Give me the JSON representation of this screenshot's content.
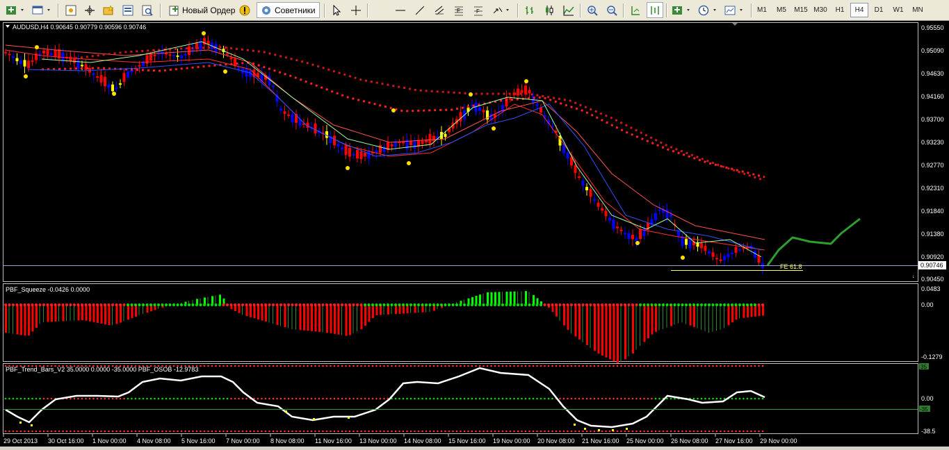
{
  "toolbar": {
    "new_order_label": "Новый Ордер",
    "advisors_label": "Советники",
    "timeframes": [
      "M1",
      "M5",
      "M15",
      "M30",
      "H1",
      "H4",
      "D1",
      "W1",
      "MN"
    ],
    "active_timeframe": "H4"
  },
  "main_chart": {
    "info_text": "AUDUSD,H4  0.90645 0.90779 0.90596 0.90746",
    "price_labels": [
      "0.95550",
      "0.95090",
      "0.94630",
      "0.94160",
      "0.93700",
      "0.93230",
      "0.92770",
      "0.92310",
      "0.91840",
      "0.91380",
      "0.90920",
      "0.90450"
    ],
    "current_price": "0.90746",
    "fe_label": "FE 61.8"
  },
  "squeeze": {
    "info_text": "PBF_Squeeze -0.0426 0.0000",
    "scale_labels": [
      "0.0483",
      "0.00",
      "-0.1279"
    ]
  },
  "trend_bars": {
    "info_text": "PBF_Trend_Bars_V2 35.0000 0.0000 -35.0000  PBF_OSOB -12.9783",
    "scale_labels": [
      "0.00",
      "-38.5"
    ],
    "marker_labels": [
      "35",
      "-35"
    ]
  },
  "time_labels": [
    "29 Oct 2013",
    "30 Oct 16:00",
    "1 Nov 00:00",
    "4 Nov 08:00",
    "5 Nov 16:00",
    "7 Nov 00:00",
    "8 Nov 08:00",
    "11 Nov 16:00",
    "13 Nov 00:00",
    "14 Nov 08:00",
    "15 Nov 16:00",
    "19 Nov 00:00",
    "20 Nov 08:00",
    "21 Nov 16:00",
    "25 Nov 00:00",
    "26 Nov 08:00",
    "27 Nov 16:00",
    "29 Nov 00:00"
  ],
  "colors": {
    "bull_candle": "#0000ff",
    "bear_candle": "#ff0000",
    "neutral_candle": "#ffff00",
    "squeeze_pos": "#00ff00",
    "squeeze_neg": "#ff0000",
    "forecast": "#2e9e2e"
  }
}
